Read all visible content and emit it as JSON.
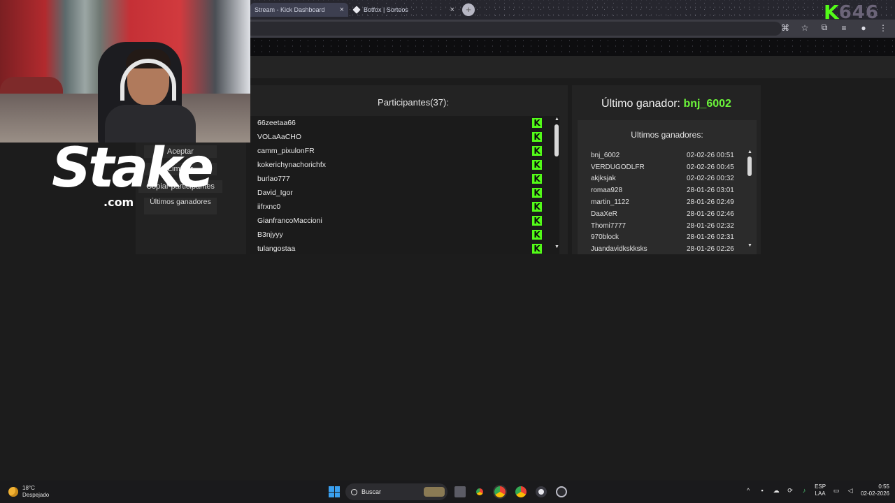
{
  "browser": {
    "tabs": [
      {
        "label": "Stream - Kick Dashboard",
        "close": "×"
      },
      {
        "label": "Botfox | Sorteos",
        "close": "×"
      }
    ],
    "new_tab": "+"
  },
  "overlay": {
    "kick_letter": "K",
    "viewer_count": "646",
    "stake_logo": "Stake",
    "stake_domain": ".com"
  },
  "controls": {
    "accept": "Aceptar",
    "clear": "Limpiar",
    "copy_participants": "Copiar participantes",
    "last_winners": "Últimos ganadores"
  },
  "participants": {
    "title": "Participantes(37):",
    "platform_badge": "K",
    "items": [
      "66zeetaa66",
      "VOLaAaCHO",
      "camm_pixulonFR",
      "kokerichynachorichfx",
      "burlao777",
      "David_Igor",
      "iifrxnc0",
      "GianfrancoMaccioni",
      "B3njyyy",
      "tulangostaa"
    ]
  },
  "winner": {
    "label": "Último ganador:",
    "name": "bnj_6002",
    "list_title": "Ultimos ganadores:",
    "rows": [
      {
        "name": "bnj_6002",
        "date": "02-02-26 00:51"
      },
      {
        "name": "VERDUGODLFR",
        "date": "02-02-26 00:45"
      },
      {
        "name": "akjksjak",
        "date": "02-02-26 00:32"
      },
      {
        "name": "romaa928",
        "date": "28-01-26 03:01"
      },
      {
        "name": "martin_1122",
        "date": "28-01-26 02:49"
      },
      {
        "name": "DaaXeR",
        "date": "28-01-26 02:46"
      },
      {
        "name": "Thomi7777",
        "date": "28-01-26 02:32"
      },
      {
        "name": "970block",
        "date": "28-01-26 02:31"
      },
      {
        "name": "Juandavidkskksks",
        "date": "28-01-26 02:26"
      }
    ]
  },
  "taskbar": {
    "temp": "18°C",
    "weather": "Despejado",
    "search_placeholder": "Buscar",
    "lang_top": "ESP",
    "lang_bottom": "LAA",
    "time": "0:55",
    "date": "02-02-2026"
  },
  "colors": {
    "kick_green": "#53fc18",
    "winner_green": "#6cf53a",
    "panel_bg": "#232323"
  }
}
